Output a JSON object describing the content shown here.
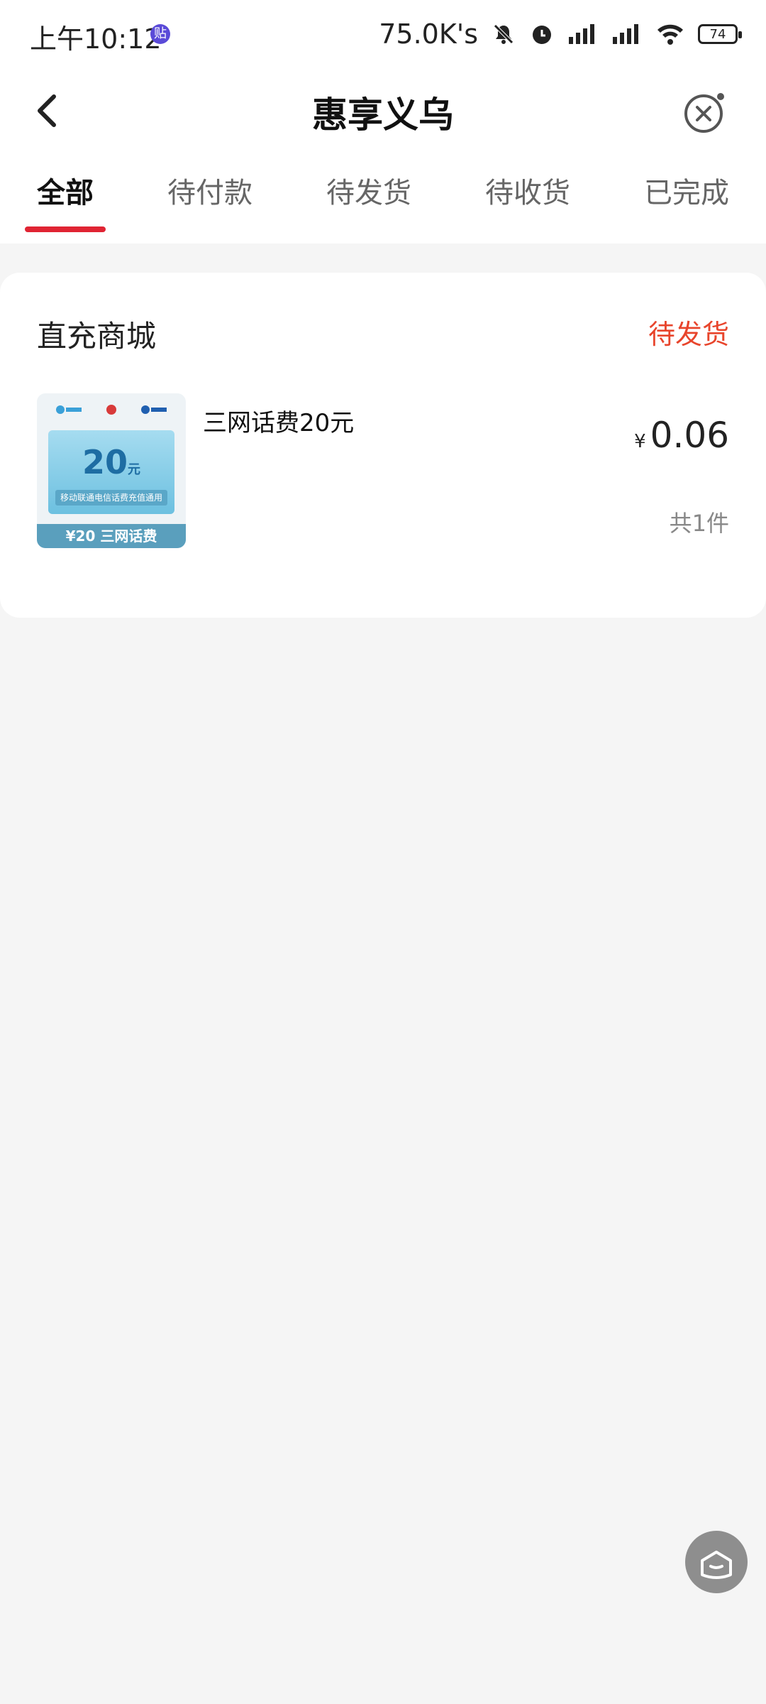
{
  "statusbar": {
    "time": "上午10:12",
    "badge": "贴",
    "speed": "75.0K's",
    "battery": "74"
  },
  "nav": {
    "title": "惠享义乌"
  },
  "tabs": [
    {
      "label": "全部",
      "active": true
    },
    {
      "label": "待付款",
      "active": false
    },
    {
      "label": "待发货",
      "active": false
    },
    {
      "label": "待收货",
      "active": false
    },
    {
      "label": "已完成",
      "active": false
    }
  ],
  "order": {
    "shop": "直充商城",
    "status": "待发货",
    "thumb": {
      "amount": "20",
      "unit": "元",
      "subtitle": "移动联通电信话费充值通用",
      "footer": "¥20 三网话费"
    },
    "product_name": "三网话费20元",
    "currency": "¥",
    "price": "0.06",
    "quantity": "共1件"
  },
  "colors": {
    "accent": "#e02433",
    "status": "#e8452c"
  }
}
